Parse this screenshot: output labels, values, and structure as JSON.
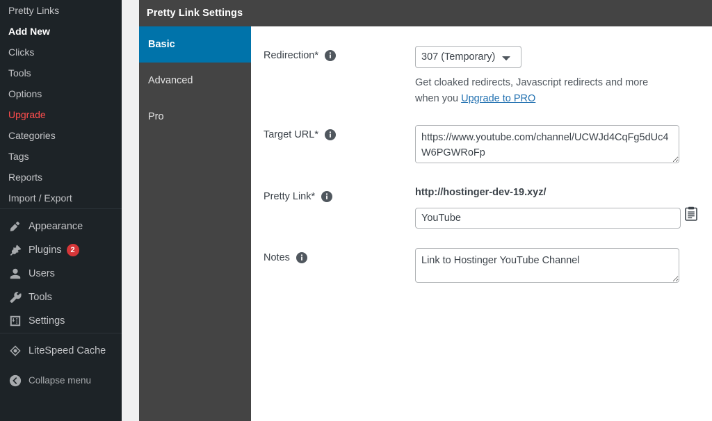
{
  "sidebar": {
    "plugin_submenu": [
      {
        "label": "Pretty Links",
        "current": false
      },
      {
        "label": "Add New",
        "current": true
      },
      {
        "label": "Clicks",
        "current": false
      },
      {
        "label": "Tools",
        "current": false
      },
      {
        "label": "Options",
        "current": false
      },
      {
        "label": "Upgrade",
        "current": false,
        "style": "upgrade"
      },
      {
        "label": "Categories",
        "current": false
      },
      {
        "label": "Tags",
        "current": false
      },
      {
        "label": "Reports",
        "current": false
      },
      {
        "label": "Import / Export",
        "current": false
      }
    ],
    "top_items": [
      {
        "label": "Appearance",
        "icon": "paintbrush-icon",
        "badge": null
      },
      {
        "label": "Plugins",
        "icon": "plug-icon",
        "badge": "2"
      },
      {
        "label": "Users",
        "icon": "user-icon",
        "badge": null
      },
      {
        "label": "Tools",
        "icon": "wrench-icon",
        "badge": null
      },
      {
        "label": "Settings",
        "icon": "sliders-icon",
        "badge": null
      }
    ],
    "extra_items": [
      {
        "label": "LiteSpeed Cache",
        "icon": "litespeed-icon"
      }
    ],
    "collapse": {
      "label": "Collapse menu",
      "icon": "collapse-arrow-icon"
    },
    "badge_color": "#d63638",
    "upgrade_color": "#ff4d4d"
  },
  "panel": {
    "title": "Pretty Link Settings",
    "header_color": "#444444",
    "accent_color": "#0073aa",
    "tabs": [
      {
        "label": "Basic",
        "active": true
      },
      {
        "label": "Advanced",
        "active": false
      },
      {
        "label": "Pro",
        "active": false
      }
    ]
  },
  "form": {
    "redirection": {
      "label": "Redirection*",
      "info_icon": "info-icon",
      "selected": "307 (Temporary)",
      "options": [
        "307 (Temporary)"
      ],
      "helper_prefix": "Get cloaked redirects, Javascript redirects and more when you ",
      "helper_link": "Upgrade to PRO"
    },
    "target_url": {
      "label": "Target URL*",
      "info_icon": "info-icon",
      "value": "https://www.youtube.com/channel/UCWJd4CqFg5dUc4W6PGWRoFp",
      "placeholder": ""
    },
    "pretty_link": {
      "label": "Pretty Link*",
      "info_icon": "info-icon",
      "base_url": "http://hostinger-dev-19.xyz/",
      "value": "YouTube",
      "placeholder": "",
      "copy_icon": "clipboard-copy-icon"
    },
    "notes": {
      "label": "Notes",
      "info_icon": "info-icon",
      "value": "Link to Hostinger YouTube Channel",
      "placeholder": ""
    }
  }
}
